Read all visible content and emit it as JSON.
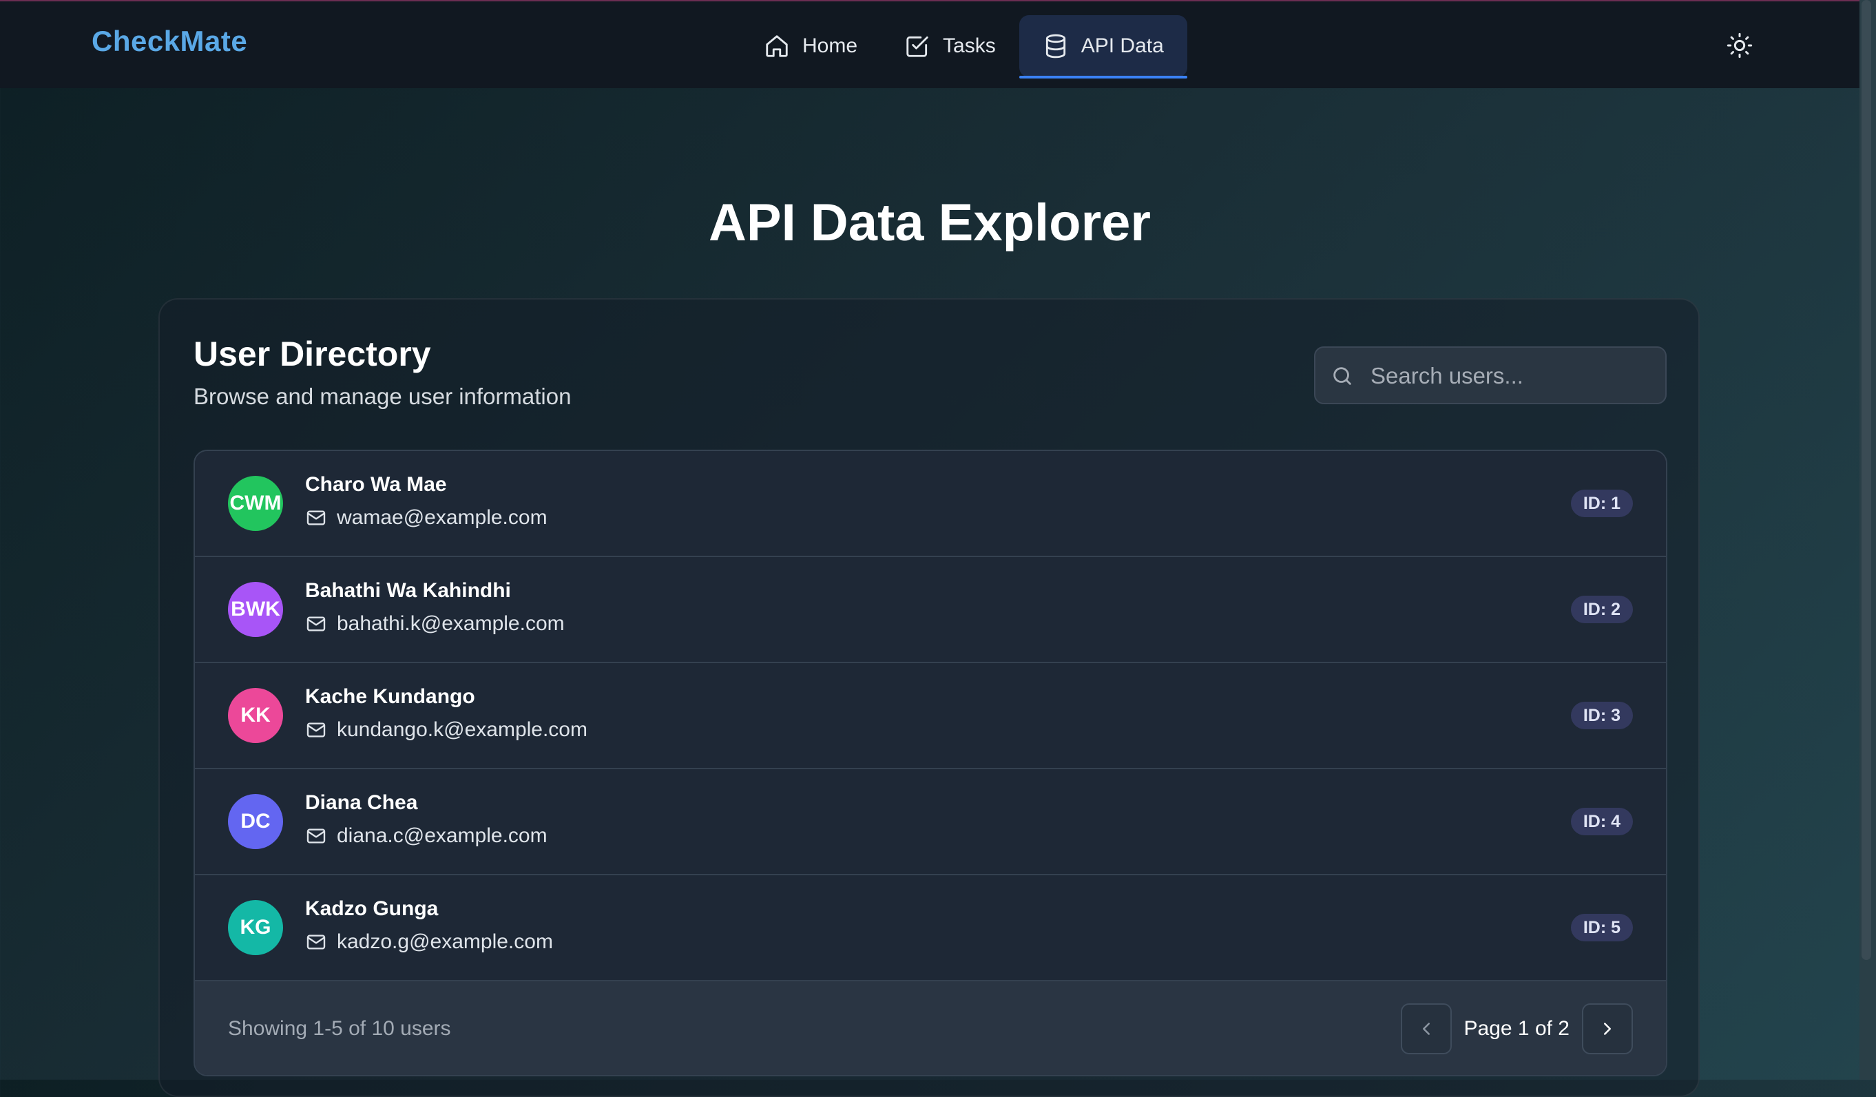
{
  "app": {
    "brand": "CheckMate"
  },
  "nav": {
    "items": [
      {
        "label": "Home",
        "icon": "home-icon"
      },
      {
        "label": "Tasks",
        "icon": "check-square-icon"
      },
      {
        "label": "API Data",
        "icon": "database-icon",
        "active": true
      }
    ]
  },
  "theme_toggle": {
    "icon": "sun-icon"
  },
  "page": {
    "title": "API Data Explorer"
  },
  "directory": {
    "title": "User Directory",
    "subtitle": "Browse and manage user information",
    "search": {
      "placeholder": "Search users...",
      "value": ""
    },
    "users": [
      {
        "initials": "CWM",
        "name": "Charo Wa Mae",
        "email": "wamae@example.com",
        "id": "ID: 1",
        "color": "#22c55e"
      },
      {
        "initials": "BWK",
        "name": "Bahathi Wa Kahindhi",
        "email": "bahathi.k@example.com",
        "id": "ID: 2",
        "color": "#a855f7"
      },
      {
        "initials": "KK",
        "name": "Kache Kundango",
        "email": "kundango.k@example.com",
        "id": "ID: 3",
        "color": "#ec4899"
      },
      {
        "initials": "DC",
        "name": "Diana Chea",
        "email": "diana.c@example.com",
        "id": "ID: 4",
        "color": "#6366f1"
      },
      {
        "initials": "KG",
        "name": "Kadzo Gunga",
        "email": "kadzo.g@example.com",
        "id": "ID: 5",
        "color": "#14b8a6"
      }
    ],
    "footer": {
      "showing": "Showing 1-5 of 10 users",
      "page_info": "Page 1 of 2"
    }
  },
  "colors": {
    "accent": "#3b82f6",
    "brand": "#5aa8e6",
    "badge_bg": "#33395e"
  }
}
